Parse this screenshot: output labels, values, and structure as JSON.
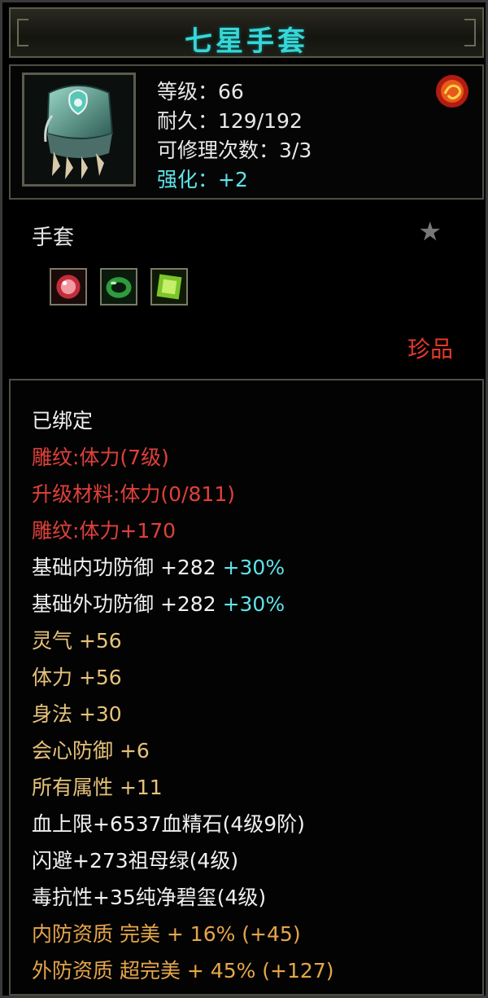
{
  "item": {
    "name": "七星手套",
    "level": "等级：66",
    "durability": "耐久：129/192",
    "repairs": "可修理次数：3/3",
    "enhance": "强化：+2",
    "type": "手套",
    "quality": "珍品"
  },
  "attributes": {
    "bound": "已绑定",
    "engrave1": "雕纹:体力(7级)",
    "upgrade": "升级材料:体力(0/811)",
    "engrave2": "雕纹:体力+170",
    "inner_def_label": "基础内功防御 +282",
    "inner_def_pct": "+30%",
    "outer_def_label": "基础外功防御 +282",
    "outer_def_pct": "+30%",
    "spirit": "灵气 +56",
    "stamina": "体力 +56",
    "agility": "身法 +30",
    "crit_def": "会心防御 +6",
    "all_attr": "所有属性 +11",
    "gem_hp": "血上限+6537血精石(4级9阶)",
    "gem_dodge": "闪避+273祖母绿(4级)",
    "gem_poison": "毒抗性+35纯净碧玺(4级)",
    "inner_quality": "内防资质 完美 + 16% (+45)",
    "outer_quality": "外防资质 超完美 + 45% (+127)"
  },
  "colors": {
    "title": "#38d6d6",
    "red": "#e0403a",
    "gold": "#e6c27a",
    "orange": "#e5a64a",
    "cyan": "#5fe3e8"
  }
}
